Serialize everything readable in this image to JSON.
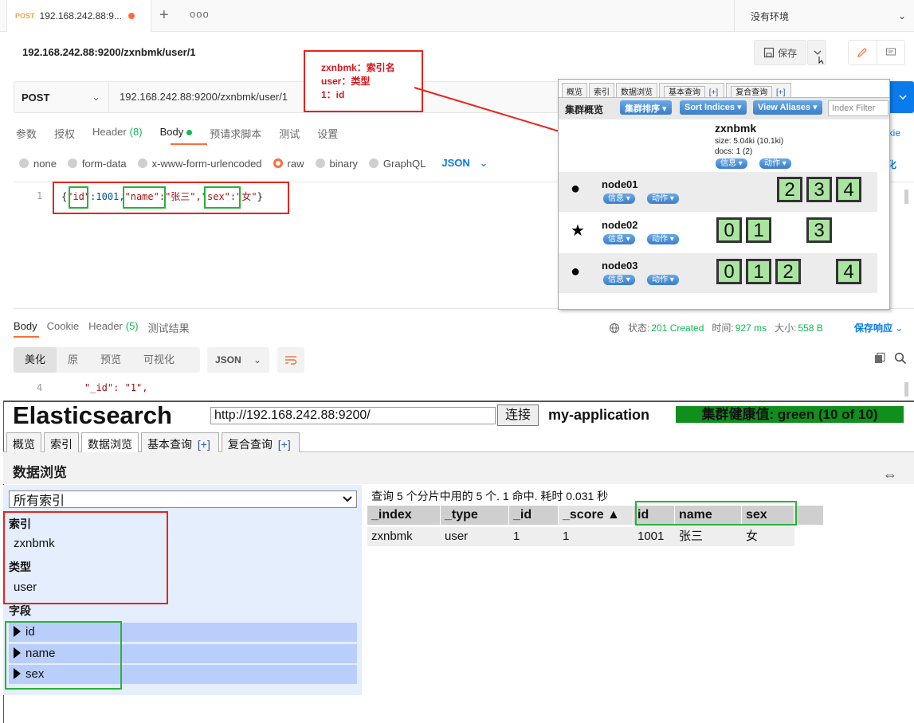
{
  "postman": {
    "tab": {
      "method": "POST",
      "url": "192.168.242.88:9..."
    },
    "environment": "没有环境",
    "url_title": "192.168.242.88:9200/zxnbmk/user/1",
    "save_label": "保存",
    "method": "POST",
    "request_url": "192.168.242.88:9200/zxnbmk/user/1",
    "request_tabs": [
      "参数",
      "授权",
      "Header",
      "(8)",
      "Body",
      "预请求脚本",
      "测试",
      "设置"
    ],
    "cookie_label": "okie",
    "body_types": [
      "none",
      "form-data",
      "x-www-form-urlencoded",
      "raw",
      "binary",
      "GraphQL"
    ],
    "body_format": "JSON",
    "beautify_label": "化",
    "code_line": "1",
    "code": {
      "open": "{",
      "k1": "\"id\"",
      "v1": ":1001,",
      "k2": "\"name\"",
      "v2": ":\"张三\",",
      "k3": "\"sex\"",
      "v3": ":\"女\"",
      "close": "}"
    },
    "response_tabs": [
      "Body",
      "Cookie",
      "Header",
      "(5)",
      "测试结果"
    ],
    "status_label": "状态:",
    "status_value": "201 Created",
    "time_label": "时间:",
    "time_value": "927 ms",
    "size_label": "大小:",
    "size_value": "558 B",
    "save_response": "保存响应",
    "view_modes": [
      "美化",
      "原",
      "预览",
      "可视化"
    ],
    "response_format": "JSON",
    "response_line": "4",
    "response_code": "\"_id\": \"1\","
  },
  "annotation": {
    "line1": "zxnbmk：索引名",
    "line2": "user：类型",
    "line3": "1：id"
  },
  "head_popup": {
    "tabs": [
      "概览",
      "索引",
      "数据浏览",
      "基本查询",
      "[+]",
      "复合查询",
      "[+]"
    ],
    "title": "集群概览",
    "buttons": [
      "集群排序 ▾",
      "Sort Indices ▾",
      "View Aliases ▾"
    ],
    "filter_placeholder": "Index Filter",
    "index": {
      "name": "zxnbmk",
      "size": "size: 5.04ki (10.1ki)",
      "docs": "docs: 1 (2)"
    },
    "info_label": "信息 ▾",
    "action_label": "动作 ▾",
    "nodes": [
      {
        "name": "node01",
        "shards": [
          "2",
          "3",
          "4"
        ]
      },
      {
        "name": "node02",
        "shards": [
          "0",
          "1",
          "3"
        ]
      },
      {
        "name": "node03",
        "shards": [
          "0",
          "1",
          "2",
          "4"
        ]
      }
    ]
  },
  "es_head": {
    "title": "Elasticsearch",
    "url": "http://192.168.242.88:9200/",
    "connect": "连接",
    "app_name": "my-application",
    "health": "集群健康值: green (10 of 10)",
    "tabs": [
      "概览",
      "索引",
      "数据浏览",
      "基本查询",
      "[+]",
      "复合查询",
      "[+]"
    ],
    "section_title": "数据浏览",
    "index_select": "所有索引",
    "index_header": "索引",
    "index_item": "zxnbmk",
    "type_header": "类型",
    "type_item": "user",
    "field_header": "字段",
    "fields": [
      "id",
      "name",
      "sex"
    ],
    "summary": "查询 5 个分片中用的 5 个. 1 命中. 耗时 0.031 秒",
    "columns": [
      "_index",
      "_type",
      "_id",
      "_score ▲",
      "id",
      "name",
      "sex"
    ],
    "row": [
      "zxnbmk",
      "user",
      "1",
      "1",
      "1001",
      "张三",
      "女"
    ]
  }
}
